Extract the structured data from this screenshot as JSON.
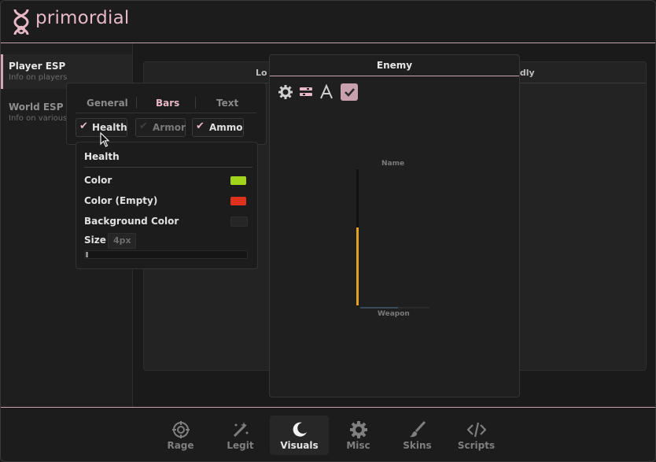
{
  "app": {
    "name": "primordial"
  },
  "sidebar": {
    "items": [
      {
        "title": "Player ESP",
        "subtitle": "Info on players"
      },
      {
        "title": "World ESP",
        "subtitle": "Info on various"
      }
    ]
  },
  "background_panel": {
    "left_label": "Lo",
    "right_label": "ndly"
  },
  "enemy_panel": {
    "title": "Enemy",
    "preview": {
      "name_label": "Name",
      "weapon_label": "Weapon",
      "health_fraction": 0.57
    }
  },
  "tabs": [
    "General",
    "Bars",
    "Text"
  ],
  "bars": [
    {
      "label": "Health",
      "checked": true
    },
    {
      "label": "Armor",
      "checked": false
    },
    {
      "label": "Ammo",
      "checked": true
    }
  ],
  "health_settings": {
    "title": "Health",
    "color_label": "Color",
    "color": "#a3d41c",
    "color_empty_label": "Color (Empty)",
    "color_empty": "#e0301e",
    "background_color_label": "Background Color",
    "background_color": "#262626",
    "size_label": "Size",
    "size_value": "4px"
  },
  "nav": [
    {
      "label": "Rage",
      "icon": "crosshair-icon"
    },
    {
      "label": "Legit",
      "icon": "wand-icon"
    },
    {
      "label": "Visuals",
      "icon": "moon-icon"
    },
    {
      "label": "Misc",
      "icon": "gear-icon"
    },
    {
      "label": "Skins",
      "icon": "brush-icon"
    },
    {
      "label": "Scripts",
      "icon": "code-icon"
    }
  ],
  "colors": {
    "accent": "#e7b9c6",
    "health_bar": "#e3a21f"
  }
}
